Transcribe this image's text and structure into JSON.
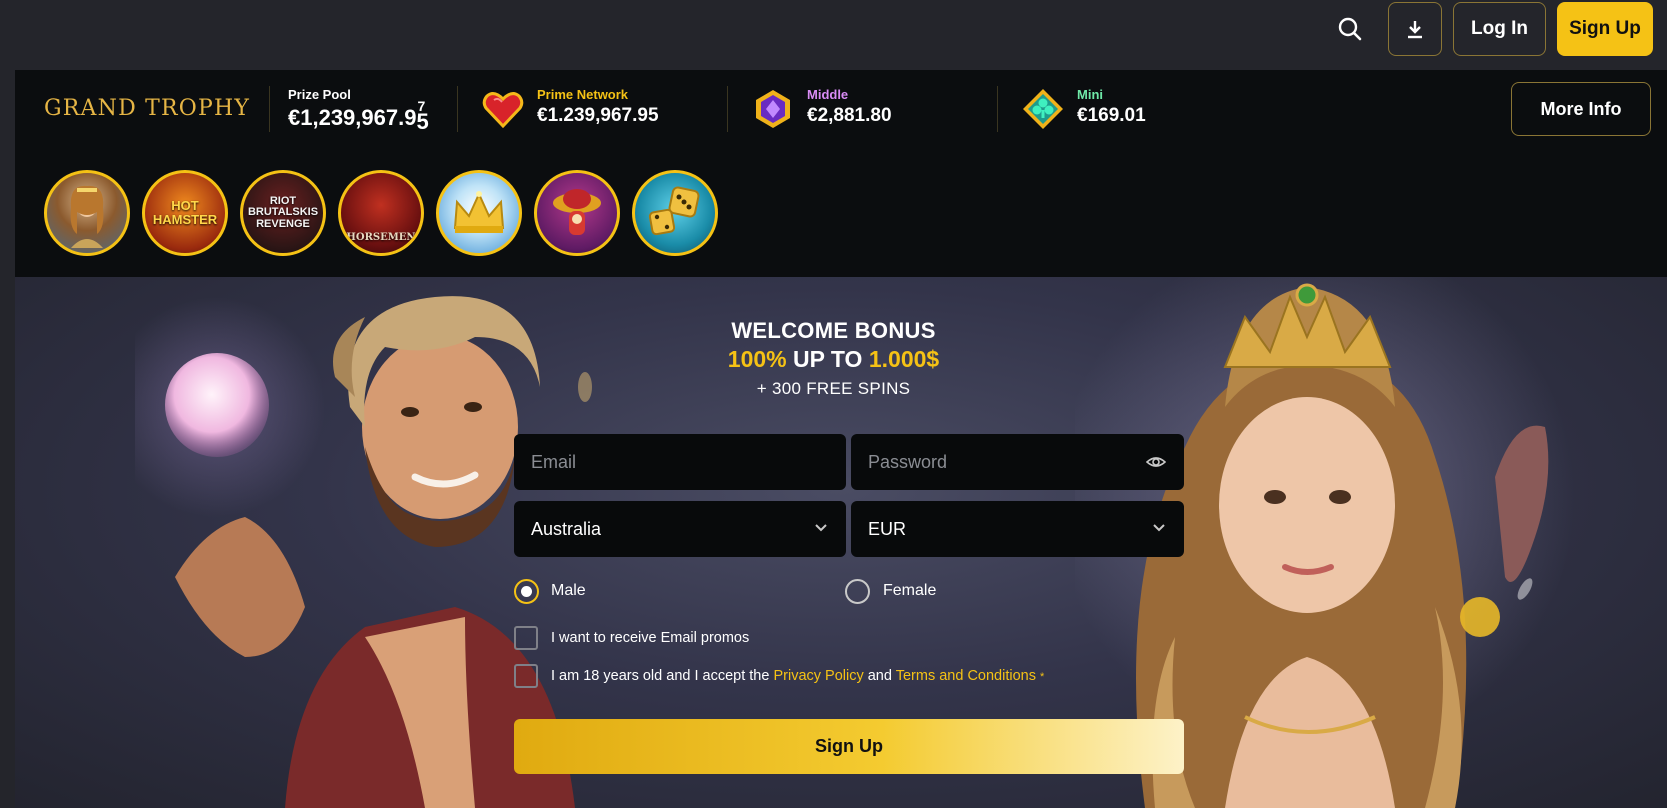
{
  "header": {
    "login_label": "Log In",
    "signup_label": "Sign Up",
    "icons": [
      "search-icon",
      "download-icon"
    ]
  },
  "jackpot": {
    "brand": "GRAND TROPHY",
    "prize_pool": {
      "label": "Prize Pool",
      "amount": "€1,239,967.9",
      "last_digit_top": "7",
      "last_digit_bottom": "5"
    },
    "tiers": [
      {
        "label": "Prime Network",
        "amount": "€1.239,967.95",
        "color": "#f5c215",
        "icon": "ruby-heart-icon"
      },
      {
        "label": "Middle",
        "amount": "€2,881.80",
        "color": "#d98cf5",
        "icon": "purple-gem-icon"
      },
      {
        "label": "Mini",
        "amount": "€169.01",
        "color": "#6fe9a8",
        "icon": "green-club-icon"
      }
    ],
    "more_info_label": "More Info"
  },
  "games": [
    {
      "name": "warrior-princess",
      "text": ""
    },
    {
      "name": "hot-hamster",
      "text": "HOT HAMSTER"
    },
    {
      "name": "riot-brutalskis-revenge",
      "text": "RIOT BRUTALSKIS REVENGE"
    },
    {
      "name": "horsemen",
      "text": "HORSEMEN"
    },
    {
      "name": "golden-crown",
      "text": ""
    },
    {
      "name": "mushroom-mariachi",
      "text": ""
    },
    {
      "name": "golden-dice",
      "text": ""
    }
  ],
  "promo": {
    "line1": "WELCOME BONUS",
    "line2_a": "100%",
    "line2_b": " UP TO ",
    "line2_c": "1.000$",
    "line3": "+ 300 FREE SPINS"
  },
  "form": {
    "email_placeholder": "Email",
    "password_placeholder": "Password",
    "country": "Australia",
    "currency": "EUR",
    "gender_options": [
      "Male",
      "Female"
    ],
    "gender_selected": "Male",
    "email_promos_label": "I want to receive Email promos",
    "age_text_a": "I am 18 years old and I accept the ",
    "privacy_link": "Privacy Policy",
    "age_text_b": " and ",
    "terms_link": "Terms and Conditions",
    "required_mark": "*",
    "submit_label": "Sign Up"
  },
  "colors": {
    "accent": "#f5c215",
    "background": "#24252b",
    "panel": "#0b0d0f",
    "field": "#080a0b"
  }
}
